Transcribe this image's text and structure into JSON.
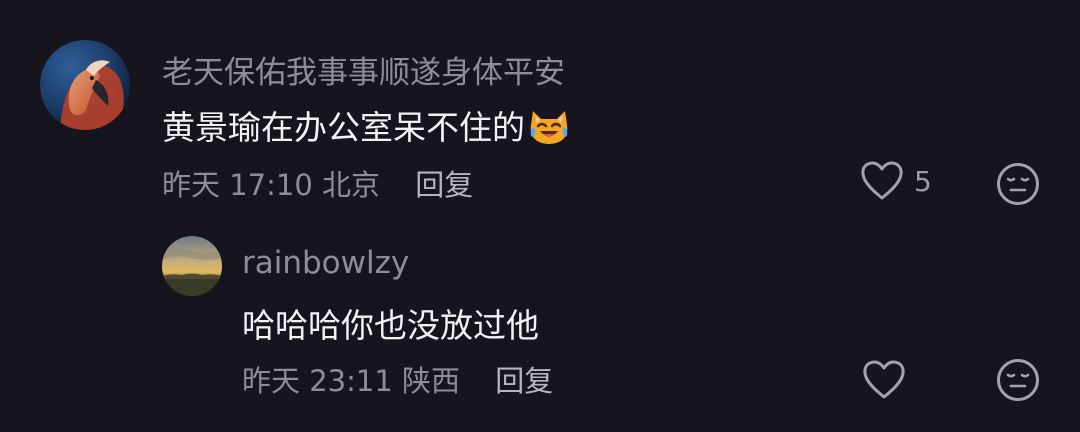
{
  "theme": {
    "background": "#16151d",
    "username_color": "#8e8c95",
    "content_color": "#f2f2f5",
    "meta_color": "#8e8c95"
  },
  "comments": [
    {
      "username": "老天保佑我事事顺遂身体平安",
      "content": "黄景瑜在办公室呆不住的",
      "content_emoji": "laughing-cat-face-with-tears",
      "time": "昨天 17:10",
      "location": "北京",
      "reply_label": "回复",
      "like_icon": "heart-outline-icon",
      "like_count": "5",
      "dislike_icon": "neutral-face-icon"
    }
  ],
  "replies": [
    {
      "username": "rainbowlzy",
      "content": "哈哈哈你也没放过他",
      "time": "昨天 23:11",
      "location": "陕西",
      "reply_label": "回复",
      "like_icon": "heart-outline-icon",
      "dislike_icon": "neutral-face-icon"
    }
  ]
}
